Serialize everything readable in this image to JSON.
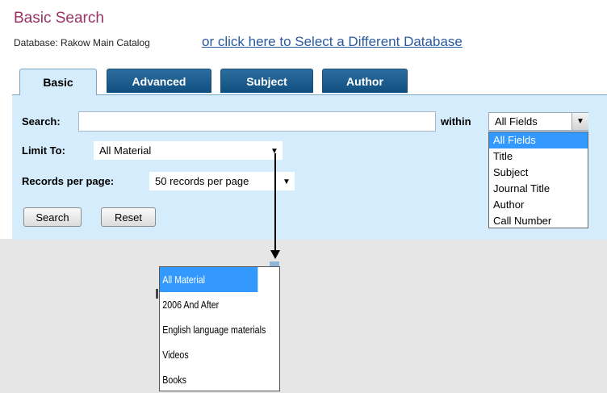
{
  "header": {
    "title": "Basic Search",
    "database_label": "Database: Rakow Main Catalog",
    "database_link": "or click here to Select a Different Database"
  },
  "tabs": [
    {
      "label": "Basic",
      "active": true
    },
    {
      "label": "Advanced",
      "active": false
    },
    {
      "label": "Subject",
      "active": false
    },
    {
      "label": "Author",
      "active": false
    }
  ],
  "form": {
    "search_label": "Search:",
    "search_value": "",
    "within_label": "within",
    "within_selected": "All Fields",
    "limit_label": "Limit To:",
    "limit_selected": "All Material",
    "records_label": "Records per page:",
    "records_selected": "50 records per page",
    "search_button": "Search",
    "reset_button": "Reset"
  },
  "within_options": [
    "All Fields",
    "Title",
    "Subject",
    "Journal Title",
    "Author",
    "Call Number"
  ],
  "limit_options": [
    "All Material",
    "2006 And After",
    "English language materials",
    "Videos",
    "Books"
  ],
  "colors": {
    "title": "#993366",
    "link": "#2a5aa0",
    "tab_active": "#d4ecfb",
    "tab_inactive": "#1a5a8a",
    "selection": "#3399ff"
  }
}
